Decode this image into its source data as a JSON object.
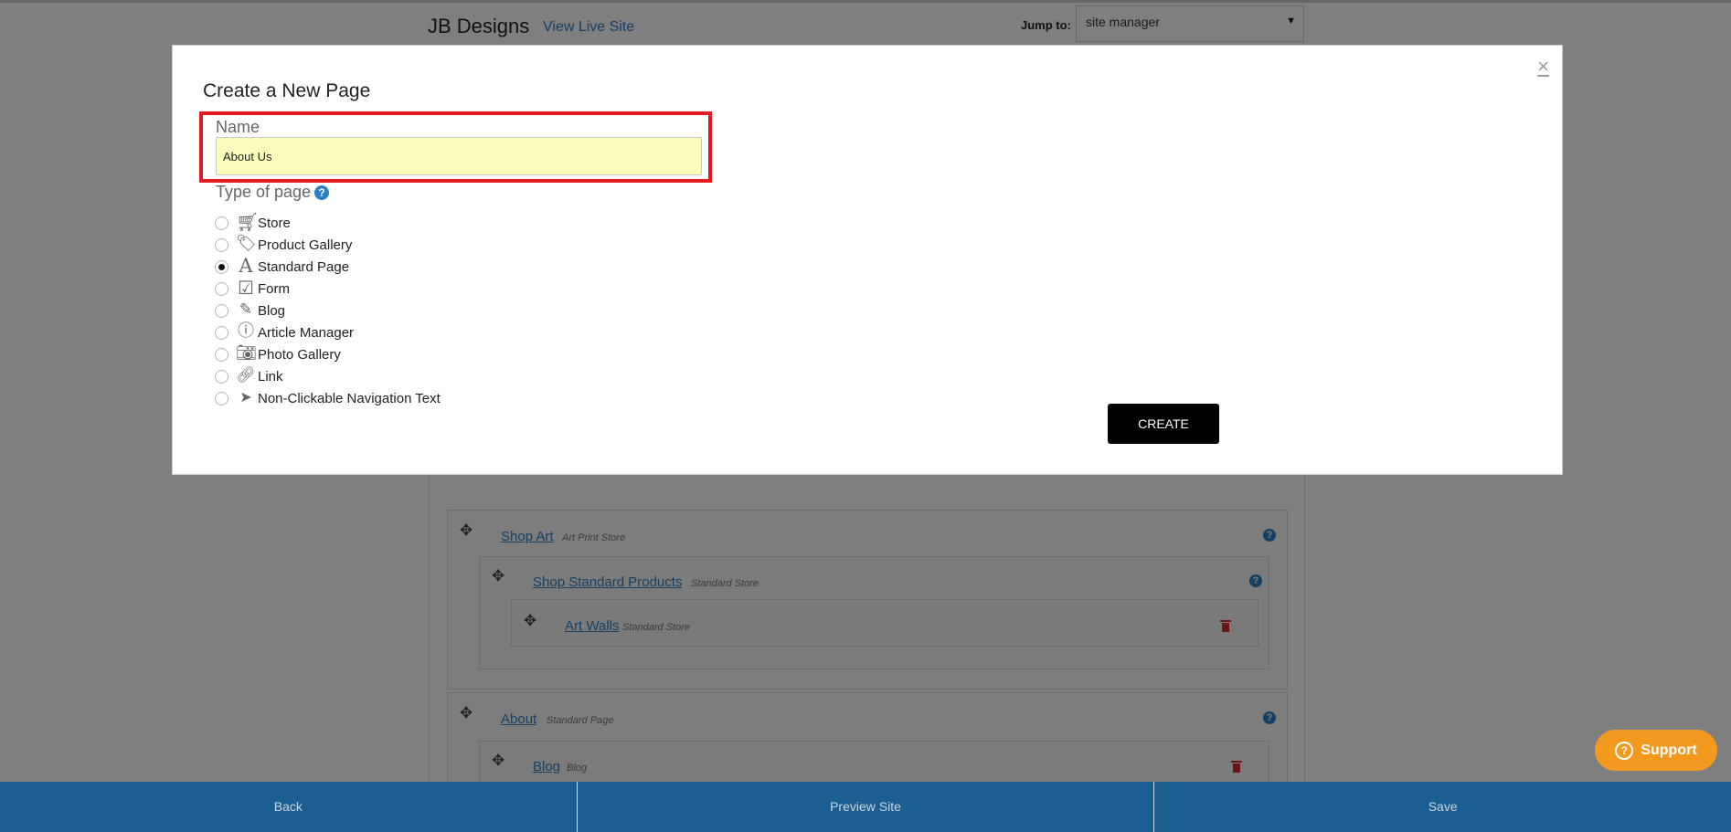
{
  "header": {
    "site_title": "JB Designs",
    "view_live_label": "View Live Site",
    "jump_label": "Jump to:",
    "jump_value": "site manager"
  },
  "modal": {
    "title": "Create a New Page",
    "close_glyph": "×",
    "name_label": "Name",
    "name_value": "About Us",
    "type_label": "Type of page",
    "help_glyph": "?",
    "page_types": [
      {
        "label": "Store",
        "icon": "cart-icon",
        "checked": false
      },
      {
        "label": "Product Gallery",
        "icon": "tags-icon",
        "checked": false
      },
      {
        "label": "Standard Page",
        "icon": "font-icon",
        "checked": true
      },
      {
        "label": "Form",
        "icon": "checkbox-icon",
        "checked": false
      },
      {
        "label": "Blog",
        "icon": "pencil-icon",
        "checked": false
      },
      {
        "label": "Article Manager",
        "icon": "info-icon",
        "checked": false
      },
      {
        "label": "Photo Gallery",
        "icon": "camera-icon",
        "checked": false
      },
      {
        "label": "Link",
        "icon": "link-icon",
        "checked": false
      },
      {
        "label": "Non-Clickable Navigation Text",
        "icon": "location-arrow-icon",
        "checked": false
      }
    ],
    "create_label": "CREATE"
  },
  "pages": {
    "shop_art": {
      "name": "Shop Art",
      "type": "Art Print Store"
    },
    "shop_standard": {
      "name": "Shop Standard Products",
      "type": "Standard Store"
    },
    "art_walls": {
      "name": "Art Walls",
      "type": "Standard Store"
    },
    "about": {
      "name": "About",
      "type": "Standard Page"
    },
    "blog": {
      "name": "Blog",
      "type": "Blog"
    }
  },
  "bottom_bar": {
    "back": "Back",
    "preview": "Preview Site",
    "save": "Save"
  },
  "support": {
    "label": "Support",
    "glyph": "?"
  },
  "colors": {
    "accent": "#2a7fc7",
    "bottom_bar": "#1b5e91",
    "support": "#f39a1e",
    "highlight": "#e01b24",
    "input_bg": "#fbfcba",
    "delete": "#d42a2a"
  }
}
